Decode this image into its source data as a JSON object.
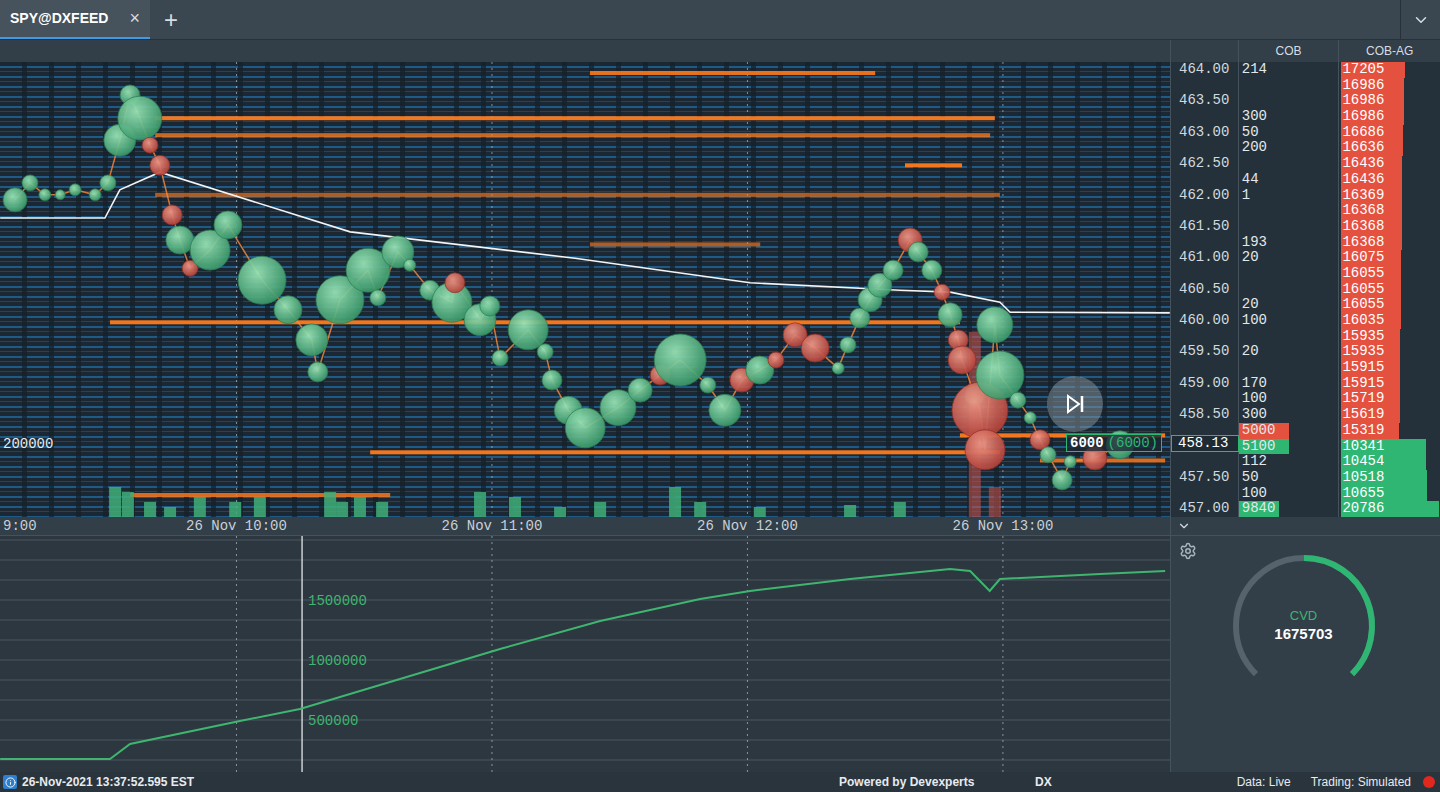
{
  "tabs": [
    {
      "label": "SPY@DXFEED",
      "close": "×",
      "selected": true
    }
  ],
  "add_tab": "+",
  "ladder": {
    "columns": [
      "COB",
      "COB-AG"
    ],
    "last_price": "458.13",
    "rows": [
      {
        "label": "464.00",
        "cob": "214",
        "cob_ag": "17205",
        "side": "ask",
        "level": 0.65,
        "cob_level": 0
      },
      {
        "label": "",
        "cob": "",
        "cob_ag": "16986",
        "side": "ask",
        "level": 0.64,
        "cob_level": 0
      },
      {
        "label": "463.50",
        "cob": "",
        "cob_ag": "16986",
        "side": "ask",
        "level": 0.64,
        "cob_level": 0
      },
      {
        "label": "",
        "cob": "300",
        "cob_ag": "16986",
        "side": "ask",
        "level": 0.64,
        "cob_level": 0
      },
      {
        "label": "463.00",
        "cob": "50",
        "cob_ag": "16686",
        "side": "ask",
        "level": 0.63,
        "cob_level": 0
      },
      {
        "label": "",
        "cob": "200",
        "cob_ag": "16636",
        "side": "ask",
        "level": 0.63,
        "cob_level": 0
      },
      {
        "label": "462.50",
        "cob": "",
        "cob_ag": "16436",
        "side": "ask",
        "level": 0.62,
        "cob_level": 0
      },
      {
        "label": "",
        "cob": "44",
        "cob_ag": "16436",
        "side": "ask",
        "level": 0.62,
        "cob_level": 0
      },
      {
        "label": "462.00",
        "cob": "1",
        "cob_ag": "16369",
        "side": "ask",
        "level": 0.62,
        "cob_level": 0
      },
      {
        "label": "",
        "cob": "",
        "cob_ag": "16368",
        "side": "ask",
        "level": 0.62,
        "cob_level": 0
      },
      {
        "label": "461.50",
        "cob": "",
        "cob_ag": "16368",
        "side": "ask",
        "level": 0.62,
        "cob_level": 0
      },
      {
        "label": "",
        "cob": "193",
        "cob_ag": "16368",
        "side": "ask",
        "level": 0.62,
        "cob_level": 0
      },
      {
        "label": "461.00",
        "cob": "20",
        "cob_ag": "16075",
        "side": "ask",
        "level": 0.61,
        "cob_level": 0
      },
      {
        "label": "",
        "cob": "",
        "cob_ag": "16055",
        "side": "ask",
        "level": 0.61,
        "cob_level": 0
      },
      {
        "label": "460.50",
        "cob": "",
        "cob_ag": "16055",
        "side": "ask",
        "level": 0.61,
        "cob_level": 0
      },
      {
        "label": "",
        "cob": "20",
        "cob_ag": "16055",
        "side": "ask",
        "level": 0.61,
        "cob_level": 0
      },
      {
        "label": "460.00",
        "cob": "100",
        "cob_ag": "16035",
        "side": "ask",
        "level": 0.61,
        "cob_level": 0
      },
      {
        "label": "",
        "cob": "",
        "cob_ag": "15935",
        "side": "ask",
        "level": 0.6,
        "cob_level": 0
      },
      {
        "label": "459.50",
        "cob": "20",
        "cob_ag": "15935",
        "side": "ask",
        "level": 0.6,
        "cob_level": 0
      },
      {
        "label": "",
        "cob": "",
        "cob_ag": "15915",
        "side": "ask",
        "level": 0.6,
        "cob_level": 0
      },
      {
        "label": "459.00",
        "cob": "170",
        "cob_ag": "15915",
        "side": "ask",
        "level": 0.6,
        "cob_level": 0
      },
      {
        "label": "",
        "cob": "100",
        "cob_ag": "15719",
        "side": "ask",
        "level": 0.6,
        "cob_level": 0
      },
      {
        "label": "458.50",
        "cob": "300",
        "cob_ag": "15619",
        "side": "ask",
        "level": 0.6,
        "cob_level": 0
      },
      {
        "label": "",
        "cob": "5000",
        "cob_ag": "15319",
        "side": "ask",
        "level": 0.59,
        "cob_level": 0.5
      },
      {
        "label": "",
        "cob": "5100",
        "cob_ag": "10341",
        "side": "bid",
        "level": 0.87,
        "cob_level": 0.5
      },
      {
        "label": "",
        "cob": "112",
        "cob_ag": "10454",
        "side": "bid",
        "level": 0.87,
        "cob_level": 0
      },
      {
        "label": "457.50",
        "cob": "50",
        "cob_ag": "10518",
        "side": "bid",
        "level": 0.88,
        "cob_level": 0
      },
      {
        "label": "",
        "cob": "100",
        "cob_ag": "10655",
        "side": "bid",
        "level": 0.88,
        "cob_level": 0
      },
      {
        "label": "457.00",
        "cob": "9840",
        "cob_ag": "20786",
        "side": "bid",
        "level": 1.0,
        "cob_level": 0.4
      }
    ]
  },
  "heatmap": {
    "scale_label": "200000",
    "order_marker": {
      "size": "6000",
      "total": "(6000)"
    },
    "time_ticks": [
      {
        "label": "9:00",
        "minute": 0
      },
      {
        "label": "26 Nov 10:00",
        "minute": 60
      },
      {
        "label": "26 Nov 11:00",
        "minute": 120
      },
      {
        "label": "26 Nov 12:00",
        "minute": 180
      },
      {
        "label": "26 Nov 13:00",
        "minute": 240
      }
    ],
    "vwap": [
      {
        "minute": 4.5,
        "price": 461.64
      },
      {
        "minute": 29.1,
        "price": 461.64
      },
      {
        "minute": 32.6,
        "price": 462.09
      },
      {
        "minute": 42.0,
        "price": 462.37
      },
      {
        "minute": 86.7,
        "price": 461.42
      },
      {
        "minute": 139.5,
        "price": 461.0
      },
      {
        "minute": 180.6,
        "price": 460.61
      },
      {
        "minute": 215.8,
        "price": 460.49
      },
      {
        "minute": 227.6,
        "price": 460.46
      },
      {
        "minute": 239.3,
        "price": 460.3
      },
      {
        "minute": 241.7,
        "price": 460.14
      },
      {
        "minute": 279.2,
        "price": 460.13
      }
    ],
    "liquidity": [
      {
        "price": 463.95,
        "from": 143.0,
        "to": 210.0,
        "weight": 0.9
      },
      {
        "price": 463.23,
        "from": 40.9,
        "to": 238.1,
        "weight": 1.0
      },
      {
        "price": 462.96,
        "from": 40.9,
        "to": 237.0,
        "weight": 0.7
      },
      {
        "price": 462.48,
        "from": 217.0,
        "to": 230.4,
        "weight": 1.0
      },
      {
        "price": 462.01,
        "from": 40.9,
        "to": 239.3,
        "weight": 0.5
      },
      {
        "price": 461.22,
        "from": 143.0,
        "to": 183.0,
        "weight": 0.5
      },
      {
        "price": 459.98,
        "from": 30.3,
        "to": 229.9,
        "weight": 1.0
      },
      {
        "price": 457.91,
        "from": 91.4,
        "to": 239.3,
        "weight": 1.0
      },
      {
        "price": 458.18,
        "from": 229.9,
        "to": 278.1,
        "weight": 1.0
      },
      {
        "price": 457.78,
        "from": 248.7,
        "to": 278.1,
        "weight": 0.8
      },
      {
        "price": 457.23,
        "from": 35.0,
        "to": 96.1,
        "weight": 0.8
      }
    ],
    "volume_bars": [
      {
        "minute": 31.5,
        "value": 30000,
        "side": "buy"
      },
      {
        "minute": 34.5,
        "value": 25000,
        "side": "buy"
      },
      {
        "minute": 39.7,
        "value": 15000,
        "side": "buy"
      },
      {
        "minute": 44.4,
        "value": 10000,
        "side": "buy"
      },
      {
        "minute": 51.4,
        "value": 20000,
        "side": "buy"
      },
      {
        "minute": 59.7,
        "value": 15000,
        "side": "buy"
      },
      {
        "minute": 65.5,
        "value": 20000,
        "side": "buy"
      },
      {
        "minute": 82.0,
        "value": 25000,
        "side": "buy"
      },
      {
        "minute": 84.8,
        "value": 15000,
        "side": "buy"
      },
      {
        "minute": 89.0,
        "value": 20000,
        "side": "buy"
      },
      {
        "minute": 94.2,
        "value": 15000,
        "side": "buy"
      },
      {
        "minute": 117.2,
        "value": 25000,
        "side": "buy"
      },
      {
        "minute": 125.4,
        "value": 20000,
        "side": "buy"
      },
      {
        "minute": 136.0,
        "value": 10000,
        "side": "buy"
      },
      {
        "minute": 145.4,
        "value": 15000,
        "side": "buy"
      },
      {
        "minute": 163.0,
        "value": 30000,
        "side": "buy"
      },
      {
        "minute": 168.9,
        "value": 15000,
        "side": "buy"
      },
      {
        "minute": 182.9,
        "value": 10000,
        "side": "buy"
      },
      {
        "minute": 204.1,
        "value": 12000,
        "side": "buy"
      },
      {
        "minute": 215.8,
        "value": 15000,
        "side": "buy"
      },
      {
        "minute": 233.4,
        "value": 185000,
        "side": "sell"
      },
      {
        "minute": 238.1,
        "value": 30000,
        "side": "sell"
      }
    ],
    "trades": [
      {
        "minute": 8.0,
        "price": 461.93,
        "volume": 14400,
        "side": "buy"
      },
      {
        "minute": 11.5,
        "price": 462.2,
        "volume": 6400,
        "side": "buy"
      },
      {
        "minute": 15.0,
        "price": 462.01,
        "volume": 3600,
        "side": "buy"
      },
      {
        "minute": 18.6,
        "price": 462.01,
        "volume": 2500,
        "side": "buy"
      },
      {
        "minute": 22.1,
        "price": 462.09,
        "volume": 3600,
        "side": "buy"
      },
      {
        "minute": 26.8,
        "price": 462.01,
        "volume": 3600,
        "side": "buy"
      },
      {
        "minute": 29.8,
        "price": 462.2,
        "volume": 6400,
        "side": "buy"
      },
      {
        "minute": 32.6,
        "price": 462.88,
        "volume": 25600,
        "side": "buy"
      },
      {
        "minute": 35.0,
        "price": 463.6,
        "volume": 10000,
        "side": "buy"
      },
      {
        "minute": 37.3,
        "price": 463.23,
        "volume": 48400,
        "side": "buy"
      },
      {
        "minute": 39.7,
        "price": 462.8,
        "volume": 6400,
        "side": "sell"
      },
      {
        "minute": 42.0,
        "price": 462.48,
        "volume": 10000,
        "side": "sell"
      },
      {
        "minute": 44.9,
        "price": 461.69,
        "volume": 10000,
        "side": "sell"
      },
      {
        "minute": 46.7,
        "price": 461.29,
        "volume": 19600,
        "side": "buy"
      },
      {
        "minute": 49.1,
        "price": 460.84,
        "volume": 6400,
        "side": "sell"
      },
      {
        "minute": 53.8,
        "price": 461.13,
        "volume": 40000,
        "side": "buy"
      },
      {
        "minute": 58.0,
        "price": 461.53,
        "volume": 19600,
        "side": "buy"
      },
      {
        "minute": 66.0,
        "price": 460.65,
        "volume": 57600,
        "side": "buy"
      },
      {
        "minute": 72.1,
        "price": 460.18,
        "volume": 19600,
        "side": "buy"
      },
      {
        "minute": 77.7,
        "price": 459.7,
        "volume": 25600,
        "side": "buy"
      },
      {
        "minute": 79.1,
        "price": 459.19,
        "volume": 10000,
        "side": "buy"
      },
      {
        "minute": 84.3,
        "price": 460.34,
        "volume": 57600,
        "side": "buy"
      },
      {
        "minute": 90.9,
        "price": 460.81,
        "volume": 48400,
        "side": "buy"
      },
      {
        "minute": 93.2,
        "price": 460.37,
        "volume": 6400,
        "side": "buy"
      },
      {
        "minute": 97.9,
        "price": 461.1,
        "volume": 25600,
        "side": "buy"
      },
      {
        "minute": 100.7,
        "price": 460.89,
        "volume": 3600,
        "side": "buy"
      },
      {
        "minute": 105.4,
        "price": 460.49,
        "volume": 10000,
        "side": "buy"
      },
      {
        "minute": 110.6,
        "price": 460.3,
        "volume": 40000,
        "side": "buy"
      },
      {
        "minute": 111.3,
        "price": 460.61,
        "volume": 10000,
        "side": "sell"
      },
      {
        "minute": 117.2,
        "price": 460.02,
        "volume": 25600,
        "side": "buy"
      },
      {
        "minute": 119.5,
        "price": 460.24,
        "volume": 10000,
        "side": "buy"
      },
      {
        "minute": 121.9,
        "price": 459.41,
        "volume": 6400,
        "side": "buy"
      },
      {
        "minute": 128.5,
        "price": 459.86,
        "volume": 40000,
        "side": "buy"
      },
      {
        "minute": 132.5,
        "price": 459.51,
        "volume": 6400,
        "side": "buy"
      },
      {
        "minute": 134.1,
        "price": 459.06,
        "volume": 10000,
        "side": "buy"
      },
      {
        "minute": 137.9,
        "price": 458.58,
        "volume": 19600,
        "side": "buy"
      },
      {
        "minute": 141.9,
        "price": 458.3,
        "volume": 40000,
        "side": "buy"
      },
      {
        "minute": 149.6,
        "price": 458.62,
        "volume": 32400,
        "side": "buy"
      },
      {
        "minute": 154.8,
        "price": 458.9,
        "volume": 14400,
        "side": "buy"
      },
      {
        "minute": 159.5,
        "price": 459.14,
        "volume": 10000,
        "side": "sell"
      },
      {
        "minute": 164.2,
        "price": 459.38,
        "volume": 67600,
        "side": "buy"
      },
      {
        "minute": 170.7,
        "price": 458.98,
        "volume": 6400,
        "side": "buy"
      },
      {
        "minute": 174.7,
        "price": 458.58,
        "volume": 25600,
        "side": "buy"
      },
      {
        "minute": 178.7,
        "price": 459.06,
        "volume": 14400,
        "side": "sell"
      },
      {
        "minute": 182.9,
        "price": 459.22,
        "volume": 19600,
        "side": "buy"
      },
      {
        "minute": 186.7,
        "price": 459.38,
        "volume": 6400,
        "side": "sell"
      },
      {
        "minute": 191.2,
        "price": 459.78,
        "volume": 14400,
        "side": "sell"
      },
      {
        "minute": 195.9,
        "price": 459.57,
        "volume": 19600,
        "side": "sell"
      },
      {
        "minute": 201.3,
        "price": 459.25,
        "volume": 3600,
        "side": "buy"
      },
      {
        "minute": 203.6,
        "price": 459.62,
        "volume": 6400,
        "side": "buy"
      },
      {
        "minute": 206.4,
        "price": 460.05,
        "volume": 10000,
        "side": "buy"
      },
      {
        "minute": 208.8,
        "price": 460.34,
        "volume": 14400,
        "side": "buy"
      },
      {
        "minute": 211.1,
        "price": 460.57,
        "volume": 14400,
        "side": "buy"
      },
      {
        "minute": 214.2,
        "price": 460.81,
        "volume": 10000,
        "side": "buy"
      },
      {
        "minute": 218.2,
        "price": 461.29,
        "volume": 14400,
        "side": "sell"
      },
      {
        "minute": 220.1,
        "price": 461.1,
        "volume": 10000,
        "side": "buy"
      },
      {
        "minute": 223.3,
        "price": 460.81,
        "volume": 10000,
        "side": "buy"
      },
      {
        "minute": 225.7,
        "price": 460.46,
        "volume": 6400,
        "side": "sell"
      },
      {
        "minute": 227.6,
        "price": 460.1,
        "volume": 14400,
        "side": "buy"
      },
      {
        "minute": 229.5,
        "price": 459.7,
        "volume": 10000,
        "side": "sell"
      },
      {
        "minute": 230.4,
        "price": 459.38,
        "volume": 19600,
        "side": "sell"
      },
      {
        "minute": 233.4,
        "price": 458.82,
        "volume": 10000,
        "side": "buy"
      },
      {
        "minute": 234.6,
        "price": 458.58,
        "volume": 78400,
        "side": "sell"
      },
      {
        "minute": 235.8,
        "price": 457.95,
        "volume": 40000,
        "side": "sell"
      },
      {
        "minute": 238.1,
        "price": 459.94,
        "volume": 32400,
        "side": "buy"
      },
      {
        "minute": 239.3,
        "price": 459.14,
        "volume": 57600,
        "side": "buy"
      },
      {
        "minute": 243.5,
        "price": 458.74,
        "volume": 6400,
        "side": "buy"
      },
      {
        "minute": 246.4,
        "price": 458.46,
        "volume": 3600,
        "side": "buy"
      },
      {
        "minute": 248.7,
        "price": 458.11,
        "volume": 10000,
        "side": "sell"
      },
      {
        "minute": 250.6,
        "price": 457.87,
        "volume": 6400,
        "side": "buy"
      },
      {
        "minute": 253.9,
        "price": 457.47,
        "volume": 10000,
        "side": "buy"
      },
      {
        "minute": 255.8,
        "price": 457.76,
        "volume": 3600,
        "side": "buy"
      },
      {
        "minute": 261.6,
        "price": 457.82,
        "volume": 14400,
        "side": "sell"
      },
      {
        "minute": 267.5,
        "price": 458.03,
        "volume": 19600,
        "side": "buy"
      }
    ]
  },
  "cvd": {
    "ticks": [
      {
        "label": "1500000",
        "value": 1500000
      },
      {
        "label": "1000000",
        "value": 1000000
      },
      {
        "label": "500000",
        "value": 500000
      }
    ],
    "crosshair_minute": 75.4,
    "series": [
      {
        "minute": 4.5,
        "value": 175000
      },
      {
        "minute": 30.3,
        "value": 175000
      },
      {
        "minute": 35.0,
        "value": 300000
      },
      {
        "minute": 60.8,
        "value": 491667
      },
      {
        "minute": 74.9,
        "value": 591667
      },
      {
        "minute": 98.4,
        "value": 841667
      },
      {
        "minute": 121.9,
        "value": 1091667
      },
      {
        "minute": 145.4,
        "value": 1325000
      },
      {
        "minute": 168.9,
        "value": 1508333
      },
      {
        "minute": 180.6,
        "value": 1575000
      },
      {
        "minute": 204.1,
        "value": 1675000
      },
      {
        "minute": 227.6,
        "value": 1758333
      },
      {
        "minute": 232.3,
        "value": 1741667
      },
      {
        "minute": 236.9,
        "value": 1575000
      },
      {
        "minute": 239.3,
        "value": 1675000
      },
      {
        "minute": 262.8,
        "value": 1716667
      },
      {
        "minute": 278.1,
        "value": 1741667
      }
    ]
  },
  "gauge": {
    "label": "CVD",
    "value": "1675703",
    "level": 0.5
  },
  "status_bar": {
    "timestamp": "26-Nov-2021 13:37:52.595 EST",
    "powered": "Powered by Devexperts",
    "brand": "DX",
    "data": "Data: Live",
    "trading": "Trading: Simulated",
    "recording": true
  }
}
